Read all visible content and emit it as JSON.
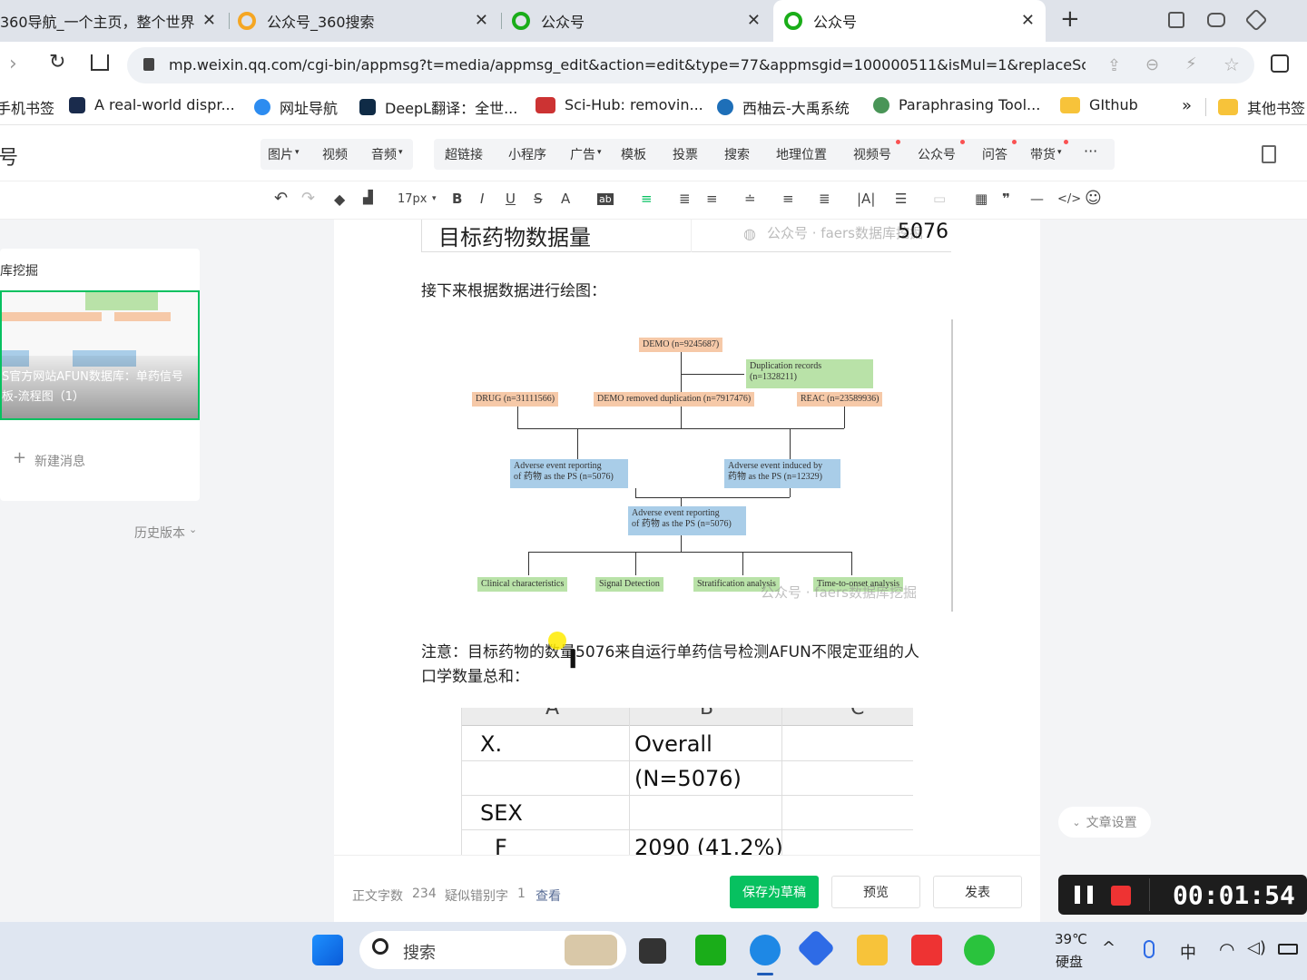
{
  "browser": {
    "tabs": [
      {
        "title": "360导航_一个主页，整个世界",
        "close": "✕"
      },
      {
        "title": "公众号_360搜索",
        "close": "✕"
      },
      {
        "title": "公众号",
        "close": "✕"
      },
      {
        "title": "公众号",
        "close": "✕",
        "active": true
      }
    ],
    "new_tab": "+",
    "url": "mp.weixin.qq.com/cgi-bin/appmsg?t=media/appmsg_edit&action=edit&type=77&appmsgid=100000511&isMul=1&replaceSce...",
    "bookmarks": [
      {
        "label": "手机书签"
      },
      {
        "label": "A real-world dispr..."
      },
      {
        "label": "网址导航"
      },
      {
        "label": "DeepL翻译：全世..."
      },
      {
        "label": "Sci-Hub: removin..."
      },
      {
        "label": "西柚云-大禹系统"
      },
      {
        "label": "Paraphrasing Tool..."
      },
      {
        "label": "GIthub"
      },
      {
        "label": "其他书签"
      }
    ],
    "more_bookmarks": "»"
  },
  "editor": {
    "brand_fragment": "号",
    "insert_tools": [
      "图片",
      "视频",
      "音频",
      "超链接",
      "小程序",
      "广告",
      "模板",
      "投票",
      "搜索",
      "地理位置",
      "视频号",
      "公众号",
      "问答",
      "带货"
    ],
    "more": "···",
    "font_size": "17px"
  },
  "left_panel": {
    "title": "库挖掘",
    "overlay_line1": "S官方网站AFUN数据库：单药信号",
    "overlay_line2": "板-流程图（1）",
    "new_message": "新建消息",
    "history": "历史版本"
  },
  "article": {
    "top_table_label": "目标药物数据量",
    "top_table_value": "5076",
    "watermark": "公众号 · faers数据库挖掘",
    "para1": "接下来根据数据进行绘图：",
    "note_line1": "注意：目标药物的数量5076来自运行单药信号检测AFUN不限定亚组的人",
    "note_line2": "口学数量总和：",
    "flowchart": {
      "demo": "DEMO (n=9245687)",
      "dup_line1": "Duplication records",
      "dup_line2": "(n=1328211)",
      "drug": "DRUG (n=31111566)",
      "demo_removed": "DEMO removed duplication (n=7917476)",
      "reac": "REAC (n=23589936)",
      "ae1_line1": "Adverse event reporting",
      "ae1_line2": "of 药物 as the PS (n=5076)",
      "ae2_line1": "Adverse event induced by",
      "ae2_line2": "药物 as the PS (n=12329)",
      "ae3_line1": "Adverse event reporting",
      "ae3_line2": "of 药物 as the PS (n=5076)",
      "out1": "Clinical characteristics",
      "out2": "Signal Detection",
      "out3": "Stratification analysis",
      "out4": "Time-to-onset analysis"
    },
    "sheet": {
      "col_a": "A",
      "col_b": "B",
      "col_c": "C",
      "r1a": "X.",
      "r1b": "Overall",
      "r2b": "(N=5076)",
      "r3a": "SEX",
      "r4a": "F",
      "r4b": "2090 (41.2%)"
    }
  },
  "footer": {
    "word_count_label": "正文字数",
    "word_count": "234",
    "typo_label": "疑似错别字",
    "typo_count": "1",
    "view": "查看",
    "save_draft": "保存为草稿",
    "preview": "预览",
    "publish": "发表"
  },
  "article_settings": "文章设置",
  "recorder": {
    "time": "00:01:54"
  },
  "taskbar": {
    "search": "搜索",
    "temp": "39℃",
    "disk": "硬盘",
    "ime": "中"
  },
  "colors": {
    "accent_green": "#07c160",
    "red_dot": "#fa5151",
    "brand_green": "#1aad19"
  }
}
